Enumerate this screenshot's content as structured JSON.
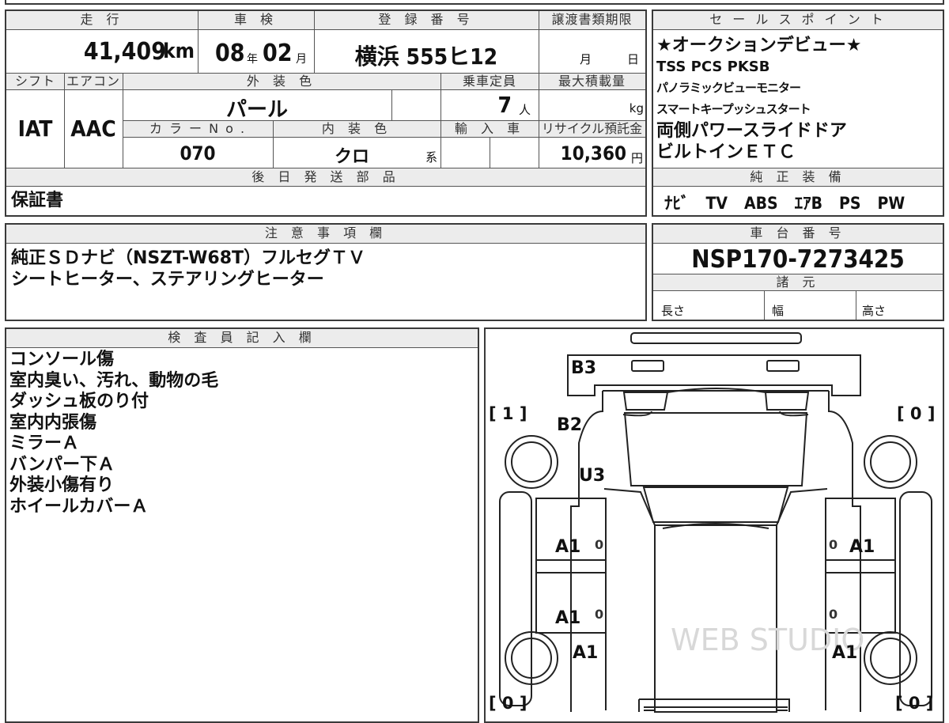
{
  "top_info": {
    "mileage_header": "走 行",
    "mileage_value": "41,409",
    "mileage_unit": "km",
    "inspection_header": "車 検",
    "inspection_year": "08",
    "inspection_year_unit": "年",
    "inspection_month": "02",
    "inspection_month_unit": "月",
    "registration_header": "登 録 番 号",
    "registration_value": "横浜 555ヒ12",
    "transfer_header": "譲渡書類期限",
    "transfer_month_unit": "月",
    "transfer_day_unit": "日"
  },
  "mid_info": {
    "shift_header": "シフト",
    "shift_value": "IAT",
    "aircon_header": "エアコン",
    "aircon_value": "AAC",
    "exterior_color_header": "外 装 色",
    "exterior_color_value": "パール",
    "capacity_header": "乗車定員",
    "capacity_value": "7",
    "capacity_unit": "人",
    "max_load_header": "最大積載量",
    "max_load_unit": "kg",
    "color_no_header": "カ ラ ー N o .",
    "color_no_value": "070",
    "interior_color_header": "内 装 色",
    "interior_color_value": "クロ",
    "interior_color_unit": "系",
    "import_header": "輸 入 車",
    "recycle_header": "リサイクル預託金",
    "recycle_value": "10,360",
    "recycle_unit": "円"
  },
  "later_parts": {
    "header": "後 日 発 送 部 品",
    "value": "保証書"
  },
  "sales_points": {
    "header": "セ ー ル ス ポ イ ン ト",
    "lines": [
      "★オークションデビュー★",
      "TSS PCS PKSB",
      "パノラミックビューモニター",
      "スマートキープッシュスタート",
      "両側パワースライドドア",
      "ビルトインＥＴＣ"
    ]
  },
  "genuine_equipment": {
    "header": "純 正 装 備",
    "value": "ﾅﾋﾞ　TV　ABS　ｴｱB　PS　PW"
  },
  "notes": {
    "header": "注 意 事 項 欄",
    "lines": [
      "純正ＳＤナビ（NSZT-W68T）フルセグＴＶ",
      "シートヒーター、ステアリングヒーター"
    ]
  },
  "chassis": {
    "header": "車 台 番 号",
    "value": "NSP170-7273425",
    "specs_header": "諸 元",
    "length_label": "長さ",
    "width_label": "幅",
    "height_label": "高さ"
  },
  "inspector": {
    "header": "検 査 員 記 入 欄",
    "lines": [
      "コンソール傷",
      "室内臭い、汚れ、動物の毛",
      "ダッシュ板のり付",
      "室内内張傷",
      "ミラーＡ",
      "バンパー下Ａ",
      "外装小傷有り",
      "ホイールカバーＡ"
    ]
  },
  "diagram": {
    "marks": {
      "rear_bumper": "B3",
      "rear_door": "B2",
      "rear_glass": "U3",
      "left_rear_door": "A1",
      "right_rear_door": "A1",
      "left_front_door": "A1",
      "left_front_fender": "A1",
      "right_front_fender": "A1",
      "left_rear_door_small": "0",
      "right_rear_door_small": "0",
      "left_front_door_small": "0",
      "right_front_door_small": "0"
    },
    "tire_left_rear": "[ 1 ]",
    "tire_right_rear": "[ 0 ]",
    "tire_left_front": "[ 0 ]",
    "tire_right_front": "[ 0 ]",
    "watermark": "WEB STUDIO"
  }
}
